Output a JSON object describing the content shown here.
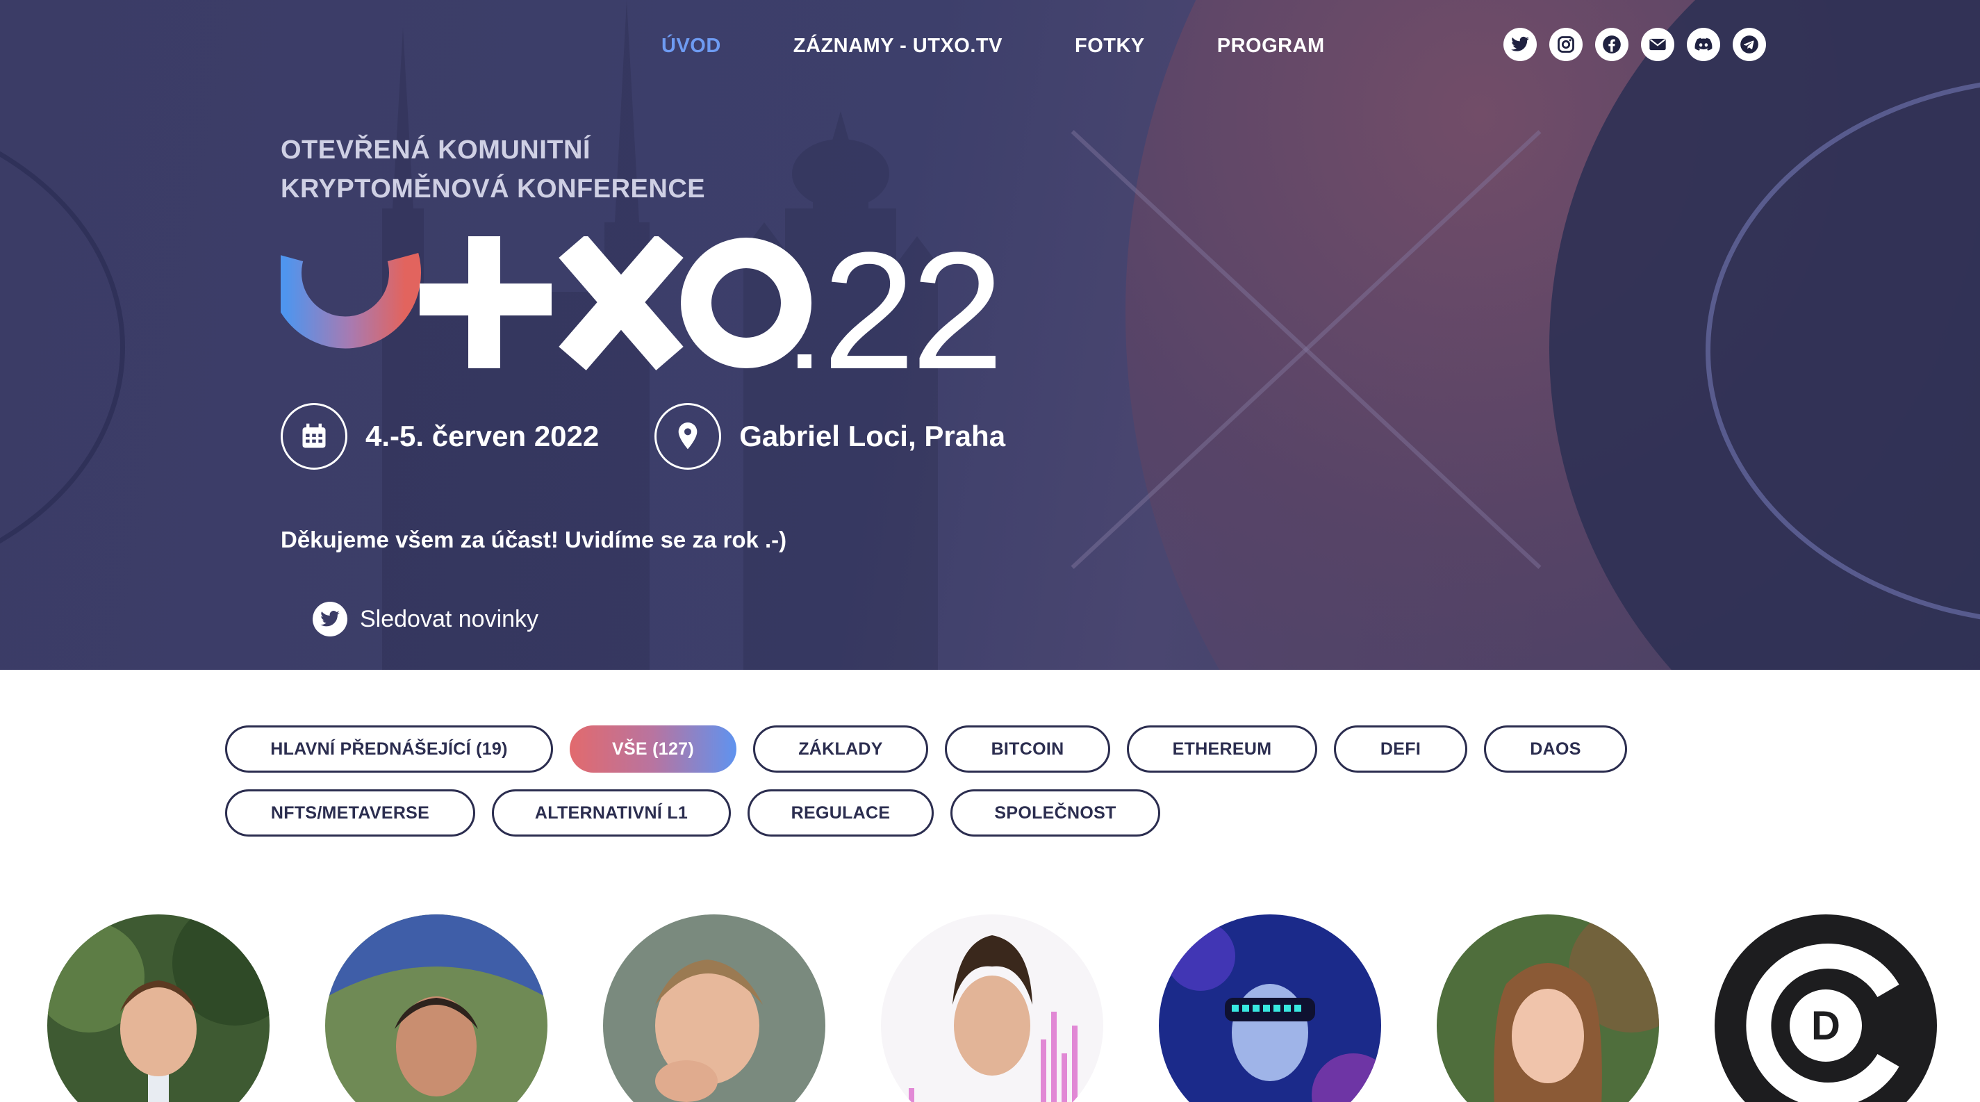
{
  "nav": {
    "items": [
      {
        "label": "ÚVOD",
        "active": true
      },
      {
        "label": "ZÁZNAMY - UTXO.TV",
        "active": false
      },
      {
        "label": "FOTKY",
        "active": false
      },
      {
        "label": "PROGRAM",
        "active": false
      }
    ],
    "social_icons": [
      "twitter-icon",
      "instagram-icon",
      "facebook-icon",
      "email-icon",
      "discord-icon",
      "telegram-icon"
    ]
  },
  "hero": {
    "subtitle_line1": "OTEVŘENÁ KOMUNITNÍ",
    "subtitle_line2": "KRYPTOMĚNOVÁ KONFERENCE",
    "logo_text": "UTXO.22",
    "date": "4.-5. červen 2022",
    "date_icon": "calendar-icon",
    "location": "Gabriel Loci, Praha",
    "location_icon": "map-pin-icon",
    "thanks": "Děkujeme všem za účast! Uvidíme se za rok .-)",
    "follow_label": "Sledovat novinky",
    "follow_icon": "twitter-icon"
  },
  "filters": {
    "row1": [
      {
        "label": "HLAVNÍ PŘEDNÁŠEJÍCÍ (19)",
        "active": false
      },
      {
        "label": "VŠE (127)",
        "active": true
      },
      {
        "label": "ZÁKLADY",
        "active": false
      },
      {
        "label": "BITCOIN",
        "active": false
      },
      {
        "label": "ETHEREUM",
        "active": false
      },
      {
        "label": "DEFI",
        "active": false
      },
      {
        "label": "DAOS",
        "active": false
      }
    ],
    "row2": [
      {
        "label": "NFTS/METAVERSE",
        "active": false
      },
      {
        "label": "ALTERNATIVNÍ L1",
        "active": false
      },
      {
        "label": "REGULACE",
        "active": false
      },
      {
        "label": "SPOLEČNOST",
        "active": false
      }
    ]
  },
  "speakers": {
    "count_visible": 7,
    "logo_letter": "D"
  },
  "colors": {
    "hero_bg": "#3b3c66",
    "nav_active": "#6e9bf2",
    "text_dark": "#2b2d4f",
    "gradient_start": "#e26a6d",
    "gradient_end": "#5f93ef"
  }
}
